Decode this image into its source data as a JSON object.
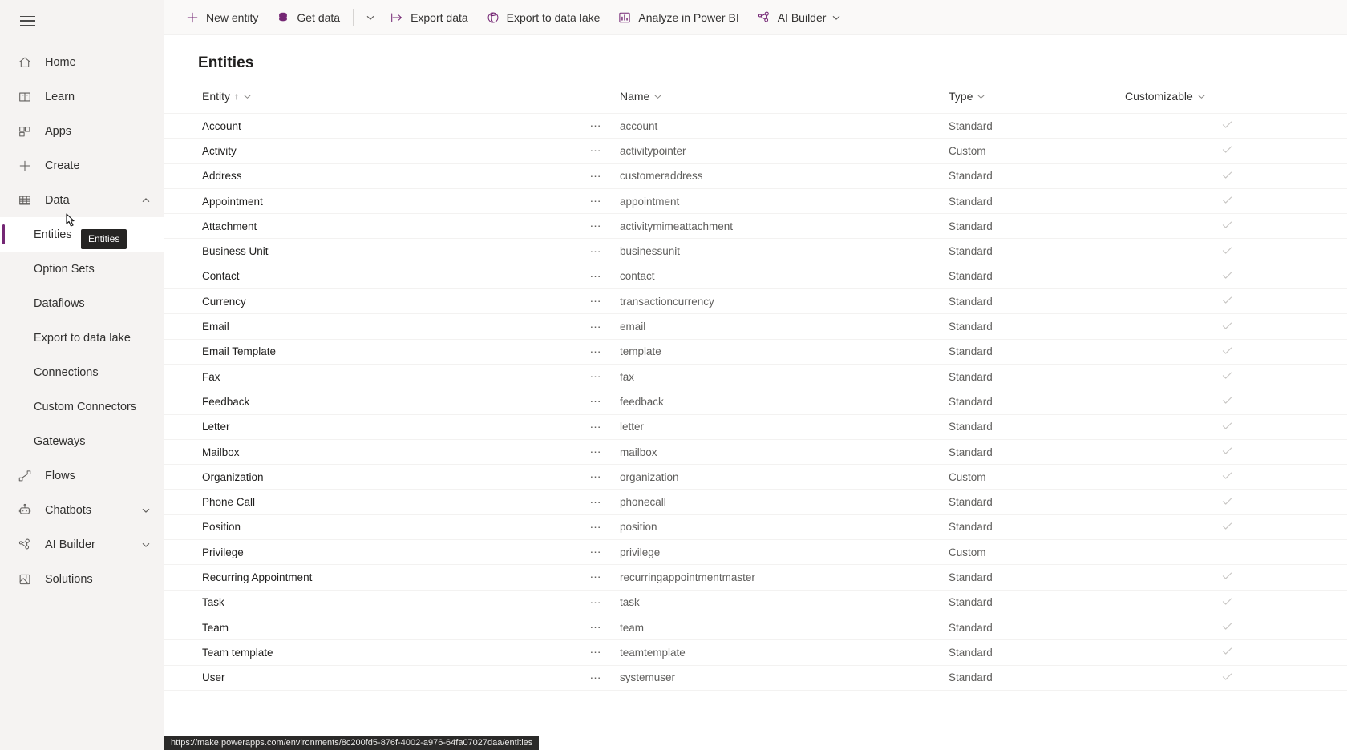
{
  "colors": {
    "accent": "#742774",
    "sidebar_bg": "#f5f3f2",
    "cmdbar_bg": "#faf9f8",
    "check": "#c8c6c4",
    "tooltip_bg": "#252423"
  },
  "sidebar": {
    "menu_button_label": "Menu",
    "items": [
      {
        "label": "Home",
        "icon": "home-icon",
        "level": "top",
        "expandable": false,
        "selected": false
      },
      {
        "label": "Learn",
        "icon": "book-icon",
        "level": "top",
        "expandable": false,
        "selected": false
      },
      {
        "label": "Apps",
        "icon": "apps-grid-icon",
        "level": "top",
        "expandable": false,
        "selected": false
      },
      {
        "label": "Create",
        "icon": "plus-icon",
        "level": "top",
        "expandable": false,
        "selected": false
      },
      {
        "label": "Data",
        "icon": "table-icon",
        "level": "top",
        "expandable": true,
        "expanded": true,
        "selected": false
      },
      {
        "label": "Entities",
        "icon": "",
        "level": "sub",
        "expandable": false,
        "selected": true
      },
      {
        "label": "Option Sets",
        "icon": "",
        "level": "sub",
        "expandable": false,
        "selected": false
      },
      {
        "label": "Dataflows",
        "icon": "",
        "level": "sub",
        "expandable": false,
        "selected": false
      },
      {
        "label": "Export to data lake",
        "icon": "",
        "level": "sub",
        "expandable": false,
        "selected": false
      },
      {
        "label": "Connections",
        "icon": "",
        "level": "sub",
        "expandable": false,
        "selected": false
      },
      {
        "label": "Custom Connectors",
        "icon": "",
        "level": "sub",
        "expandable": false,
        "selected": false
      },
      {
        "label": "Gateways",
        "icon": "",
        "level": "sub",
        "expandable": false,
        "selected": false
      },
      {
        "label": "Flows",
        "icon": "flow-icon",
        "level": "top",
        "expandable": false,
        "selected": false
      },
      {
        "label": "Chatbots",
        "icon": "bot-icon",
        "level": "top",
        "expandable": true,
        "expanded": false,
        "selected": false
      },
      {
        "label": "AI Builder",
        "icon": "ai-builder-icon",
        "level": "top",
        "expandable": true,
        "expanded": false,
        "selected": false
      },
      {
        "label": "Solutions",
        "icon": "solutions-icon",
        "level": "top",
        "expandable": false,
        "selected": false
      }
    ],
    "tooltip": {
      "text": "Entities"
    }
  },
  "commandbar": {
    "commands": [
      {
        "label": "New entity",
        "icon": "plus-icon",
        "chevron": false,
        "split": false
      },
      {
        "label": "Get data",
        "icon": "database-icon",
        "chevron": false,
        "split": true
      },
      {
        "label": "Export data",
        "icon": "export-icon",
        "chevron": false,
        "split": false
      },
      {
        "label": "Export to data lake",
        "icon": "data-lake-icon",
        "chevron": false,
        "split": false
      },
      {
        "label": "Analyze in Power BI",
        "icon": "power-bi-icon",
        "chevron": false,
        "split": false
      },
      {
        "label": "AI Builder",
        "icon": "ai-builder-icon",
        "chevron": true,
        "split": false
      }
    ]
  },
  "page": {
    "title": "Entities"
  },
  "table": {
    "columns": [
      {
        "label": "Entity",
        "sorted": true,
        "sort_dir": "↑",
        "chevron": true
      },
      {
        "label": "Name",
        "sorted": false,
        "sort_dir": "",
        "chevron": true
      },
      {
        "label": "Type",
        "sorted": false,
        "sort_dir": "",
        "chevron": true
      },
      {
        "label": "Customizable",
        "sorted": false,
        "sort_dir": "",
        "chevron": true
      }
    ],
    "row_menu_glyph": "⋯",
    "check_glyph": "check-icon",
    "rows": [
      {
        "entity": "Account",
        "name": "account",
        "type": "Standard",
        "customizable": true
      },
      {
        "entity": "Activity",
        "name": "activitypointer",
        "type": "Custom",
        "customizable": true
      },
      {
        "entity": "Address",
        "name": "customeraddress",
        "type": "Standard",
        "customizable": true
      },
      {
        "entity": "Appointment",
        "name": "appointment",
        "type": "Standard",
        "customizable": true
      },
      {
        "entity": "Attachment",
        "name": "activitymimeattachment",
        "type": "Standard",
        "customizable": true
      },
      {
        "entity": "Business Unit",
        "name": "businessunit",
        "type": "Standard",
        "customizable": true
      },
      {
        "entity": "Contact",
        "name": "contact",
        "type": "Standard",
        "customizable": true
      },
      {
        "entity": "Currency",
        "name": "transactioncurrency",
        "type": "Standard",
        "customizable": true
      },
      {
        "entity": "Email",
        "name": "email",
        "type": "Standard",
        "customizable": true
      },
      {
        "entity": "Email Template",
        "name": "template",
        "type": "Standard",
        "customizable": true
      },
      {
        "entity": "Fax",
        "name": "fax",
        "type": "Standard",
        "customizable": true
      },
      {
        "entity": "Feedback",
        "name": "feedback",
        "type": "Standard",
        "customizable": true
      },
      {
        "entity": "Letter",
        "name": "letter",
        "type": "Standard",
        "customizable": true
      },
      {
        "entity": "Mailbox",
        "name": "mailbox",
        "type": "Standard",
        "customizable": true
      },
      {
        "entity": "Organization",
        "name": "organization",
        "type": "Custom",
        "customizable": true
      },
      {
        "entity": "Phone Call",
        "name": "phonecall",
        "type": "Standard",
        "customizable": true
      },
      {
        "entity": "Position",
        "name": "position",
        "type": "Standard",
        "customizable": true
      },
      {
        "entity": "Privilege",
        "name": "privilege",
        "type": "Custom",
        "customizable": false
      },
      {
        "entity": "Recurring Appointment",
        "name": "recurringappointmentmaster",
        "type": "Standard",
        "customizable": true
      },
      {
        "entity": "Task",
        "name": "task",
        "type": "Standard",
        "customizable": true
      },
      {
        "entity": "Team",
        "name": "team",
        "type": "Standard",
        "customizable": true
      },
      {
        "entity": "Team template",
        "name": "teamtemplate",
        "type": "Standard",
        "customizable": true
      },
      {
        "entity": "User",
        "name": "systemuser",
        "type": "Standard",
        "customizable": true
      }
    ]
  },
  "statusbar": {
    "url": "https://make.powerapps.com/environments/8c200fd5-876f-4002-a976-64fa07027daa/entities"
  }
}
